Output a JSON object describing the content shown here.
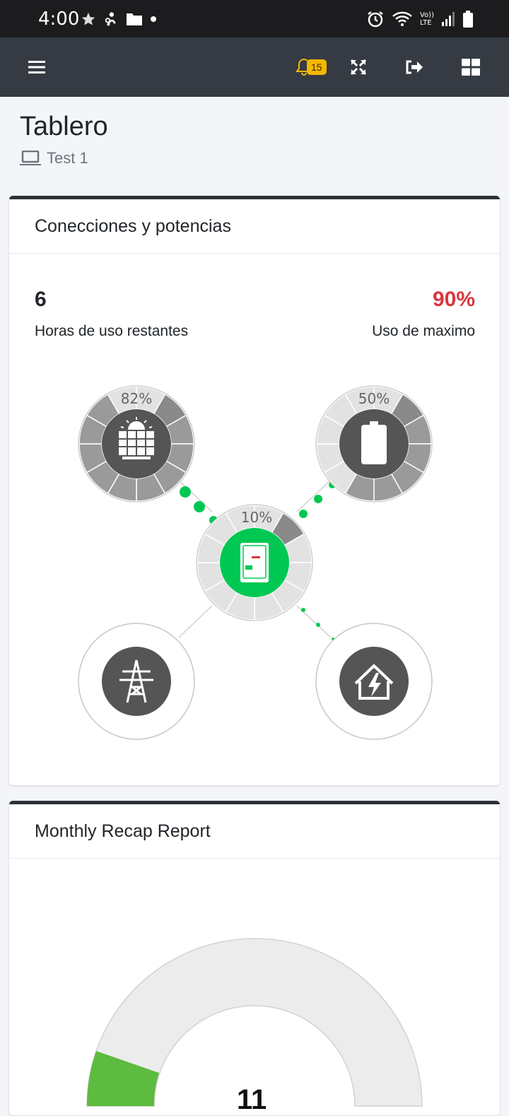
{
  "status_bar": {
    "time": "4:00",
    "left_icons": [
      "star-icon",
      "person-icon",
      "folder-icon",
      "dot-icon"
    ],
    "right_icons": [
      "alarm-icon",
      "wifi-icon",
      "volte-icon",
      "signal-icon",
      "battery-icon"
    ],
    "volte_label_top": "Vo))",
    "volte_label_bottom": "LTE"
  },
  "navbar": {
    "menu_icon": "hamburger-icon",
    "notifications_count": "15",
    "actions": [
      "bell-icon",
      "fullscreen-icon",
      "logout-icon",
      "grid-icon"
    ]
  },
  "page": {
    "title": "Tablero",
    "device_icon": "laptop-icon",
    "device_name": "Test 1"
  },
  "connections_card": {
    "title": "Conecciones y potencias",
    "hours_value": "6",
    "hours_label": "Horas de uso restantes",
    "max_use_value": "90%",
    "max_use_label": "Uso de maximo",
    "accent_red": "#d9363e",
    "accent_green": "#00c853",
    "nodes": {
      "solar": {
        "percent": "82%",
        "level": 0.82,
        "icon": "solar-panel-icon"
      },
      "battery": {
        "percent": "50%",
        "level": 0.5,
        "icon": "battery-icon"
      },
      "inverter": {
        "percent": "10%",
        "level": 0.1,
        "icon": "inverter-icon"
      },
      "grid": {
        "icon": "power-tower-icon"
      },
      "home": {
        "icon": "home-power-icon"
      }
    }
  },
  "recap_card": {
    "title": "Monthly Recap Report",
    "gauge_value": "11",
    "gauge_color": "#5dbb3f",
    "gauge_track_color": "#ececec"
  }
}
